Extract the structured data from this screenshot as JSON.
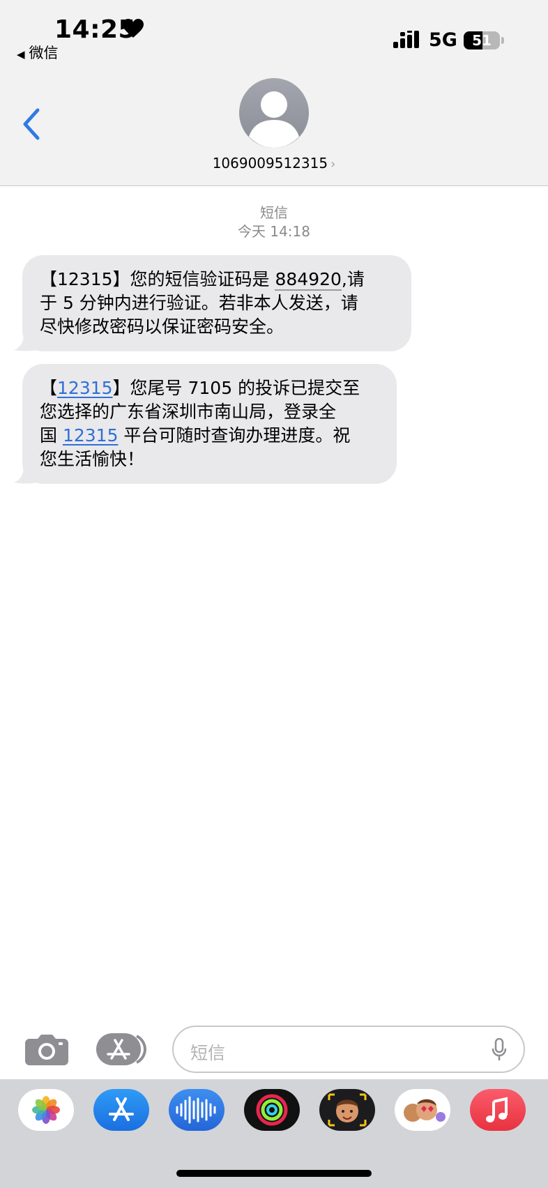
{
  "status_bar": {
    "time": "14:25",
    "back_app": "微信",
    "network": "5G",
    "battery": "51",
    "battery_level": 0.51
  },
  "header": {
    "contact": "1069009512315",
    "chevron": "›"
  },
  "thread": {
    "label": "短信",
    "timestamp": "今天 14:18"
  },
  "messages": [
    {
      "line1_prefix": "【12315】您的短信验证码是 ",
      "code": "884920",
      "line1_suffix": ",请",
      "line2": "于 5 分钟内进行验证。若非本人发送，请",
      "line3": "尽快修改密码以保证密码安全。"
    },
    {
      "open_bracket": "【",
      "link1": "12315",
      "line1_suffix": "】您尾号 7105 的投诉已提交至",
      "line2": "您选择的广东省深圳市南山局，登录全",
      "line3_prefix": "国 ",
      "link2": "12315",
      "line3_suffix": " 平台可随时查询办理进度。祝",
      "line4": "您生活愉快！"
    }
  ],
  "composer": {
    "placeholder": "短信"
  },
  "colors": {
    "accent": "#2f7ae5",
    "bubble": "#e9e9eb",
    "link": "#2f6fd6"
  },
  "dock": {
    "apps": [
      "photos-icon",
      "app-store-icon",
      "audio-messages-icon",
      "fitness-icon",
      "memoji-icon",
      "animoji-icon",
      "music-icon"
    ]
  }
}
